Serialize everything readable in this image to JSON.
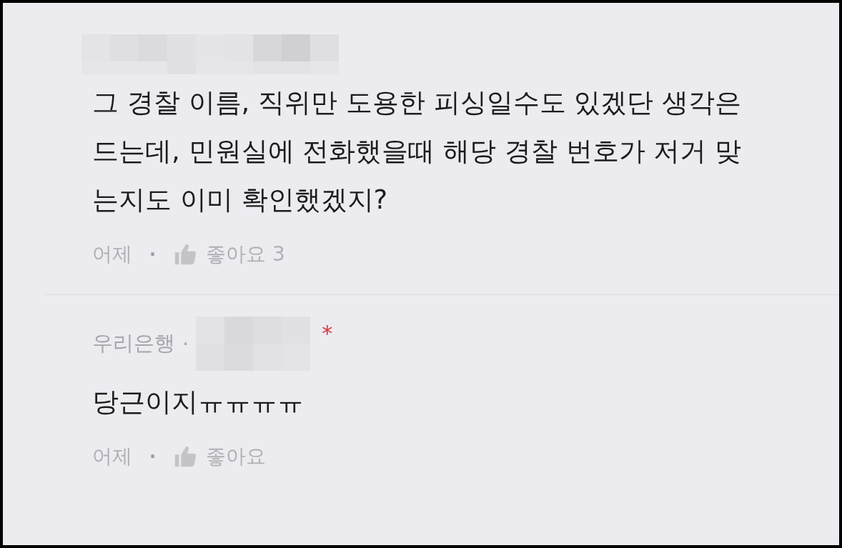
{
  "comments": [
    {
      "lines": [
        "그 경찰 이름, 직위만 도용한 피싱일수도 있겠단 생각은",
        "드는데, 민원실에 전화했을때 해당 경찰 번호가 저거 맞",
        "는지도 이미 확인했겠지?"
      ],
      "time": "어제",
      "dot": "·",
      "like_label": "좋아요",
      "like_count": "3"
    },
    {
      "author": "우리은행",
      "author_sep": "·",
      "badge": "*",
      "lines": [
        "당근이지ㅠㅠㅠㅠ"
      ],
      "time": "어제",
      "dot": "·",
      "like_label": "좋아요"
    }
  ]
}
